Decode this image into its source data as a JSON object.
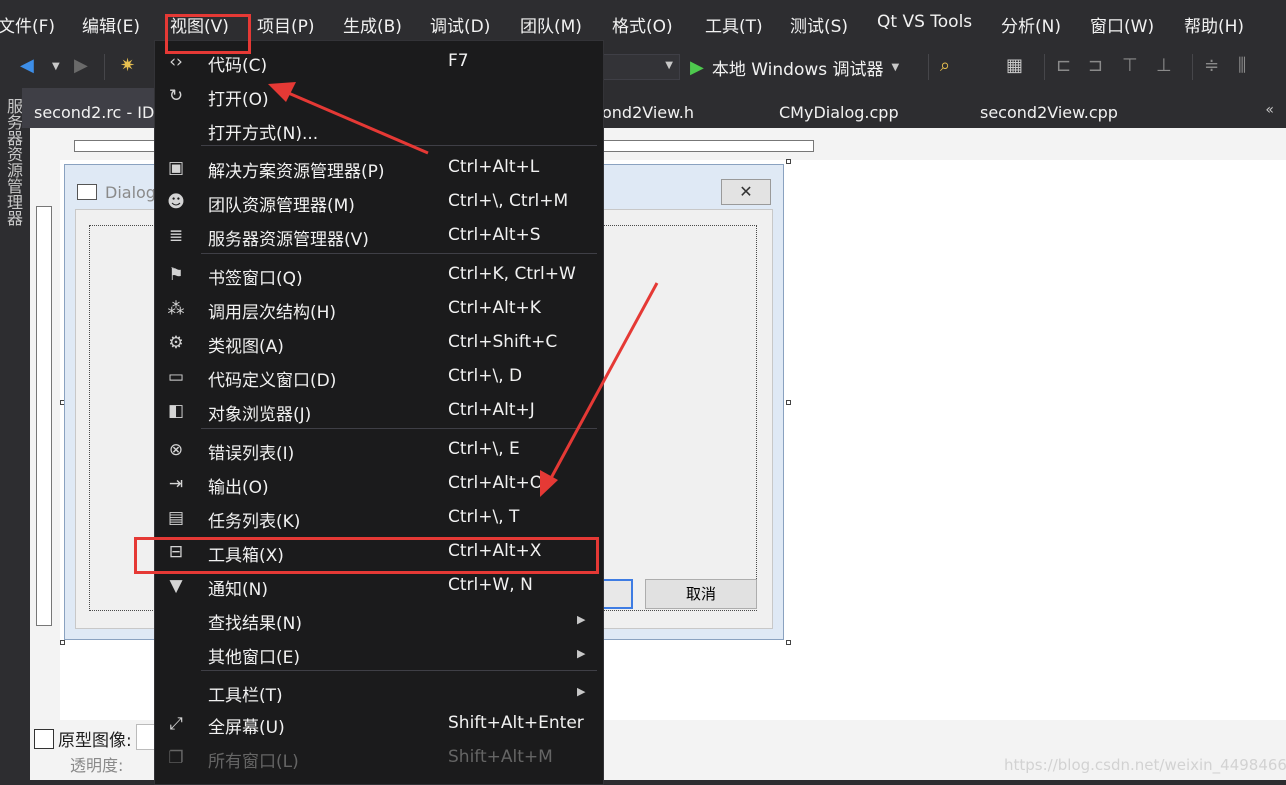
{
  "menubar": [
    "文件(F)",
    "编辑(E)",
    "视图(V)",
    "项目(P)",
    "生成(B)",
    "调试(D)",
    "团队(M)",
    "格式(O)",
    "工具(T)",
    "测试(S)",
    "Qt VS Tools",
    "分析(N)",
    "窗口(W)",
    "帮助(H)"
  ],
  "toolbar": {
    "run_label": "本地 Windows 调试器"
  },
  "side_panel_label": "服务器资源管理器",
  "tabs": [
    "second2.rc - ID",
    "ond2View.h",
    "CMyDialog.cpp",
    "second2View.cpp"
  ],
  "tab_overflow": "«",
  "dialog": {
    "title": "Dialog",
    "cancel": "取消"
  },
  "prototype_label": "原型图像:",
  "opacity_label": "透明度:",
  "watermark": "https://blog.csdn.net/weixin_44984664",
  "view_menu": {
    "items": [
      {
        "icon": "code-icon",
        "glyph": "‹›",
        "label": "代码(C)",
        "shortcut": "F7"
      },
      {
        "icon": "open-icon",
        "glyph": "↻",
        "label": "打开(O)",
        "shortcut": ""
      },
      {
        "icon": "none",
        "glyph": "",
        "label": "打开方式(N)...",
        "shortcut": ""
      },
      {
        "icon": "solution-explorer-icon",
        "glyph": "▣",
        "label": "解决方案资源管理器(P)",
        "shortcut": "Ctrl+Alt+L"
      },
      {
        "icon": "team-explorer-icon",
        "glyph": "☻",
        "label": "团队资源管理器(M)",
        "shortcut": "Ctrl+\\, Ctrl+M"
      },
      {
        "icon": "server-explorer-icon",
        "glyph": "≣",
        "label": "服务器资源管理器(V)",
        "shortcut": "Ctrl+Alt+S"
      },
      {
        "icon": "bookmark-window-icon",
        "glyph": "⚑",
        "label": "书签窗口(Q)",
        "shortcut": "Ctrl+K, Ctrl+W"
      },
      {
        "icon": "call-hierarchy-icon",
        "glyph": "⁂",
        "label": "调用层次结构(H)",
        "shortcut": "Ctrl+Alt+K"
      },
      {
        "icon": "class-view-icon",
        "glyph": "⚙",
        "label": "类视图(A)",
        "shortcut": "Ctrl+Shift+C"
      },
      {
        "icon": "code-definition-icon",
        "glyph": "▭",
        "label": "代码定义窗口(D)",
        "shortcut": "Ctrl+\\, D"
      },
      {
        "icon": "object-browser-icon",
        "glyph": "◧",
        "label": "对象浏览器(J)",
        "shortcut": "Ctrl+Alt+J"
      },
      {
        "icon": "error-list-icon",
        "glyph": "⊗",
        "label": "错误列表(I)",
        "shortcut": "Ctrl+\\, E"
      },
      {
        "icon": "output-icon",
        "glyph": "⇥",
        "label": "输出(O)",
        "shortcut": "Ctrl+Alt+O"
      },
      {
        "icon": "task-list-icon",
        "glyph": "▤",
        "label": "任务列表(K)",
        "shortcut": "Ctrl+\\, T"
      },
      {
        "icon": "toolbox-icon",
        "glyph": "⊟",
        "label": "工具箱(X)",
        "shortcut": "Ctrl+Alt+X"
      },
      {
        "icon": "notification-icon",
        "glyph": "▼",
        "label": "通知(N)",
        "shortcut": "Ctrl+W, N"
      },
      {
        "icon": "none",
        "glyph": "",
        "label": "查找结果(N)",
        "shortcut": "",
        "submenu": true
      },
      {
        "icon": "none",
        "glyph": "",
        "label": "其他窗口(E)",
        "shortcut": "",
        "submenu": true
      },
      {
        "icon": "none",
        "glyph": "",
        "label": "工具栏(T)",
        "shortcut": "",
        "submenu": true
      },
      {
        "icon": "fullscreen-icon",
        "glyph": "⤢",
        "label": "全屏幕(U)",
        "shortcut": "Shift+Alt+Enter"
      },
      {
        "icon": "all-windows-icon",
        "glyph": "❐",
        "label": "所有窗口(L)",
        "shortcut": "Shift+Alt+M",
        "disabled": true
      }
    ]
  },
  "colors": {
    "menu_bg": "#1b1b1c",
    "ide_bg": "#2d2d30",
    "highlight_red": "#e53935",
    "run_green": "#4ec94e"
  }
}
